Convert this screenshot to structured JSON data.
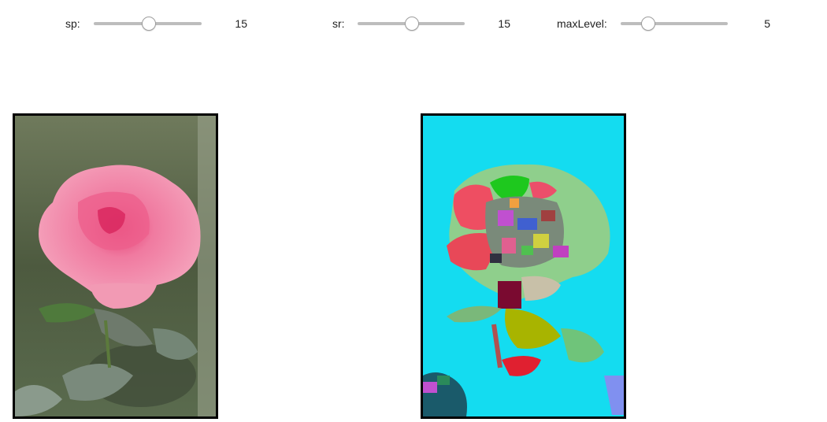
{
  "controls": {
    "sp": {
      "label": "sp:",
      "value": "15",
      "fraction": 0.5
    },
    "sr": {
      "label": "sr:",
      "value": "15",
      "fraction": 0.5
    },
    "maxLevel": {
      "label": "maxLevel:",
      "value": "5",
      "fraction": 0.25
    }
  },
  "images": {
    "original": {
      "subject": "pink rose photo"
    },
    "segmented": {
      "subject": "mean-shift segmented rose",
      "background_color": "#14dcf0"
    }
  }
}
